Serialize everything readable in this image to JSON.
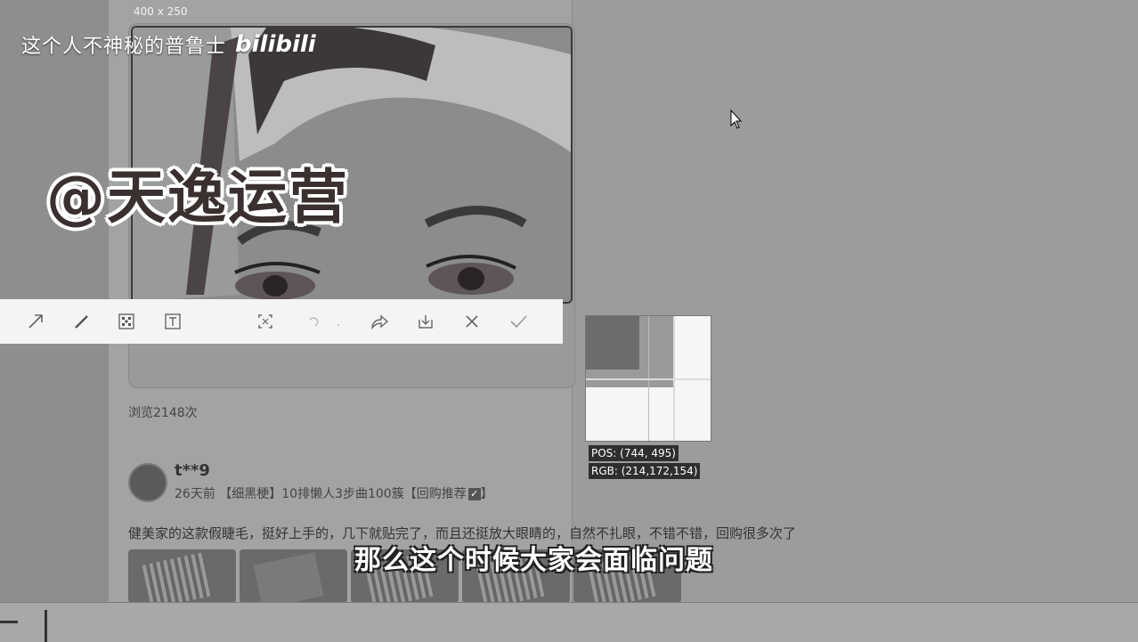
{
  "capture": {
    "size_label": "400 x 250",
    "pos_readout": "POS: (744, 495)",
    "rgb_readout": "RGB: (214,172,154)"
  },
  "watermark": {
    "name": "这个人不神秘的普鲁士",
    "logo": "bilibili"
  },
  "overlay_text": "@天逸运营",
  "toolbar": {
    "tools": [
      {
        "name": "arrow-tool-icon"
      },
      {
        "name": "pen-tool-icon"
      },
      {
        "name": "mosaic-tool-icon"
      },
      {
        "name": "text-tool-icon"
      },
      {
        "name": "ocr-tool-icon"
      },
      {
        "name": "undo-icon"
      },
      {
        "name": "redo-icon"
      },
      {
        "name": "share-icon"
      },
      {
        "name": "download-icon"
      },
      {
        "name": "close-icon"
      },
      {
        "name": "confirm-check-icon"
      }
    ]
  },
  "product": {
    "views": "浏览2148次"
  },
  "review": {
    "reviewer": "t**9",
    "meta": "26天前 【细黑梗】10排懒人3步曲100簇【回购推荐",
    "meta_end": "】",
    "text": "健美家的这款假睫毛，挺好上手的，几下就贴完了，而且还挺放大眼睛的，自然不扎眼，不错不错，回购很多次了"
  },
  "subtitle": "那么这个时候大家会面临问题"
}
